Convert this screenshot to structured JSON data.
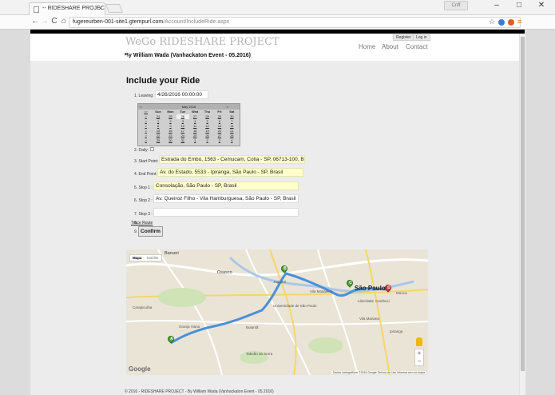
{
  "browser": {
    "tab_title": "-- RIDESHARE PROJEC",
    "tab_close": "×",
    "profile_label": "Cnff",
    "win_min": "–",
    "win_max": "□",
    "win_close": "✕",
    "back": "←",
    "forward": "→",
    "reload": "C",
    "home": "⌂",
    "url_host": "fugereurben-001-site1.gtempurl.com",
    "url_path": "/Account/IncludeRide.aspx",
    "star": "☆",
    "menu": "≡"
  },
  "header": {
    "site_title": "WeGo RIDESHARE PROJECT",
    "subtitle": "By William Wada (Vanhackaton Event - 05.2016)",
    "register": "Register",
    "login": "Log in",
    "nav": [
      "Home",
      "About",
      "Contact"
    ]
  },
  "form": {
    "heading": "Include your Ride",
    "leaving_label": "1. Leaving:",
    "leaving_value": "4/26/2016 00:00:00",
    "daily_label": "2. Daily:",
    "start_label": "3. Start Point:",
    "start_value": "Estrada do Embú, 1563 - Cemucam, Cotia - SP, 06713-100, B",
    "end_label": "4. End Point:",
    "end_value": "Av. do Estado, 5533 - Ipiranga, São Paulo - SP, Brasil",
    "stop1_label": "5. Stop 1 :",
    "stop1_value": "Consolação, São Paulo - SP, Brasil",
    "stop2_label": "6. Stop 2 :",
    "stop2_value": "Av. Queiroz Filho - Vila Hamburguesa, São Paulo - SP, Brasil",
    "stop3_label": "7. Stop 3 :",
    "stop3_value": "",
    "trace_prefix": "8.",
    "trace_label": "Trace Route",
    "confirm_prefix": "9.",
    "confirm_label": "Confirm"
  },
  "calendar": {
    "prev": "<",
    "month": "May 2016",
    "next": ">",
    "week_sel": ">>",
    "days": [
      "Sun",
      "Mon",
      "Tue",
      "Wed",
      "Thu",
      "Fri",
      "Sat"
    ],
    "weeks": [
      [
        ">",
        "24",
        "25",
        "26",
        "27",
        "28",
        "29",
        "30"
      ],
      [
        ">",
        "1",
        "2",
        "3",
        "4",
        "5",
        "6",
        "7"
      ],
      [
        ">",
        "8",
        "9",
        "10",
        "11",
        "12",
        "13",
        "14"
      ],
      [
        ">",
        "15",
        "16",
        "17",
        "18",
        "19",
        "20",
        "21"
      ],
      [
        ">",
        "22",
        "23",
        "24",
        "25",
        "26",
        "27",
        "28"
      ],
      [
        ">",
        "29",
        "30",
        "31",
        "1",
        "2",
        "3",
        "4"
      ]
    ]
  },
  "map": {
    "tab_map": "Mapa",
    "tab_satellite": "Satélite",
    "city_label": "São Paulo",
    "labels": [
      "Barueri",
      "Osasco",
      "Jaguaré",
      "Vila Madalena",
      "Taboão da Serra",
      "Universidade de São Paulo",
      "Mooca",
      "Cambuci",
      "Liberdade",
      "Vila Mariana",
      "Ipiranga",
      "Carapicuíba",
      "Granja Viana",
      "Butantã"
    ],
    "markers": [
      "A",
      "B",
      "C",
      "D"
    ],
    "zoom_in": "+",
    "zoom_out": "−",
    "google": "Google",
    "credits": "Dados cartográficos ©2016 Google   Termos de Uso   Informar erro no mapa",
    "colors": {
      "route": "#4a90d9",
      "marker_green": "#57a13a",
      "marker_red": "#d93a2e"
    }
  },
  "footer": {
    "text": "© 2016 - RIDESHARE PROJECT - By William Wada (Vanhackaton Event - 05.2016)"
  }
}
